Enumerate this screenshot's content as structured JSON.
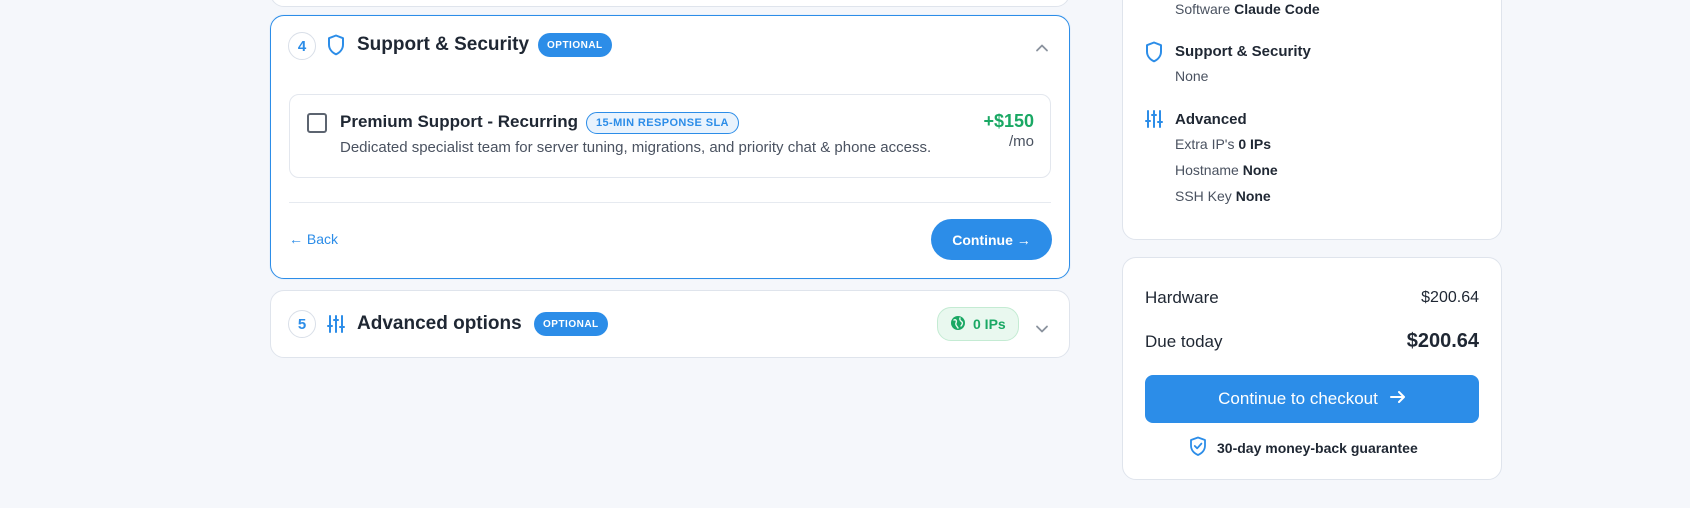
{
  "steps": {
    "support": {
      "number": "4",
      "title": "Support & Security",
      "badge": "OPTIONAL",
      "option": {
        "title": "Premium Support - Recurring",
        "badge": "15-MIN RESPONSE SLA",
        "description": "Dedicated specialist team for server tuning, migrations, and priority chat & phone access.",
        "price": "+$150",
        "price_unit": "/mo",
        "checked": false
      },
      "back_label": "← Back",
      "continue_label": "Continue →"
    },
    "advanced": {
      "number": "5",
      "title": "Advanced options",
      "badge": "OPTIONAL",
      "ips_label": "0 IPs"
    }
  },
  "summary": {
    "software": {
      "label": "Software",
      "value": "Claude Code"
    },
    "support": {
      "title": "Support & Security",
      "value": "None"
    },
    "advanced": {
      "title": "Advanced",
      "extra_ips_label": "Extra IP's",
      "extra_ips_value": "0 IPs",
      "hostname_label": "Hostname",
      "hostname_value": "None",
      "ssh_label": "SSH Key",
      "ssh_value": "None"
    }
  },
  "totals": {
    "hardware_label": "Hardware",
    "hardware_value": "$200.64",
    "due_label": "Due today",
    "due_value": "$200.64",
    "checkout_label": "Continue to checkout",
    "guarantee": "30-day money-back guarantee"
  },
  "colors": {
    "accent": "#2c8de8",
    "success": "#1aa864",
    "background": "#f5f7fb"
  },
  "icons": [
    "shield-icon",
    "sliders-icon",
    "chevron-up-icon",
    "chevron-down-icon",
    "globe-icon",
    "arrow-right-icon",
    "shield-check-icon"
  ]
}
